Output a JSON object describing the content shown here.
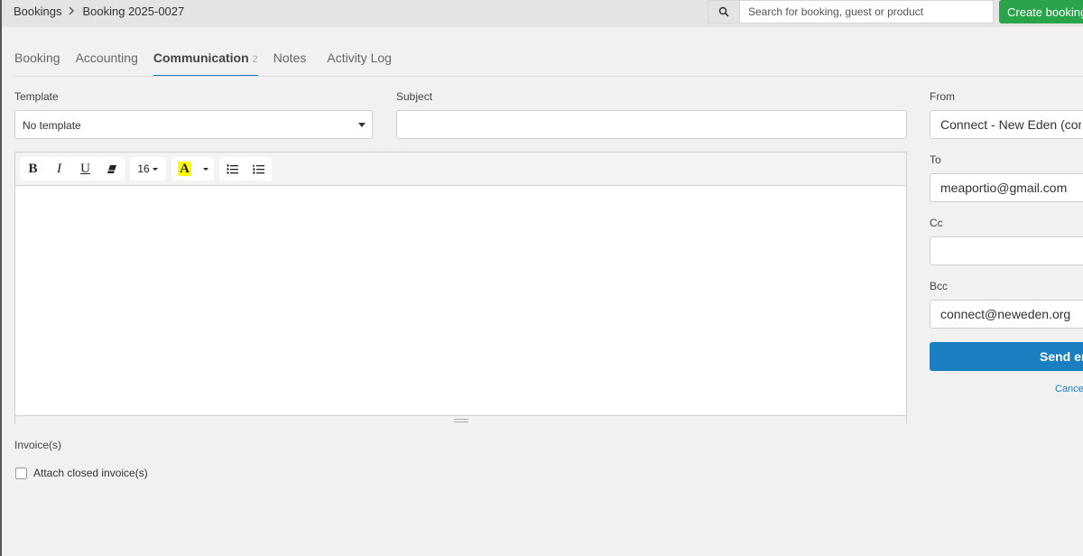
{
  "breadcrumb": {
    "items": [
      "Bookings",
      "Booking 2025-0027"
    ]
  },
  "header": {
    "search_placeholder": "Search for booking, guest or product",
    "create_label": "Create booking"
  },
  "tabs": [
    {
      "label": "Booking"
    },
    {
      "label": "Accounting"
    },
    {
      "label": "Communication",
      "count": "2",
      "active": true
    },
    {
      "label": "Notes"
    },
    {
      "label": "Activity Log"
    }
  ],
  "form": {
    "template_label": "Template",
    "template_value": "No template",
    "subject_label": "Subject",
    "subject_value": "",
    "from_label": "From",
    "from_value": "Connect - New Eden (connect@neweden.org)",
    "to_label": "To",
    "to_value": "meaportio@gmail.com",
    "cc_label": "Cc",
    "cc_value": "",
    "bcc_label": "Bcc",
    "bcc_value": "connect@neweden.org",
    "send_label": "Send email",
    "cancel_label": "Cancel"
  },
  "editor": {
    "bold": "B",
    "italic": "I",
    "underline": "U",
    "font_size": "16",
    "highlight": "A",
    "highlight_color": "#ffff00",
    "icons": [
      "eraser-icon",
      "chevron-down-icon",
      "bullet-list-icon",
      "numbered-list-icon"
    ]
  },
  "invoices": {
    "label": "Invoice(s)",
    "attach_label": "Attach closed invoice(s)",
    "attach_checked": false
  },
  "colors": {
    "primary": "#1a7fc1",
    "success": "#2aa44b"
  }
}
